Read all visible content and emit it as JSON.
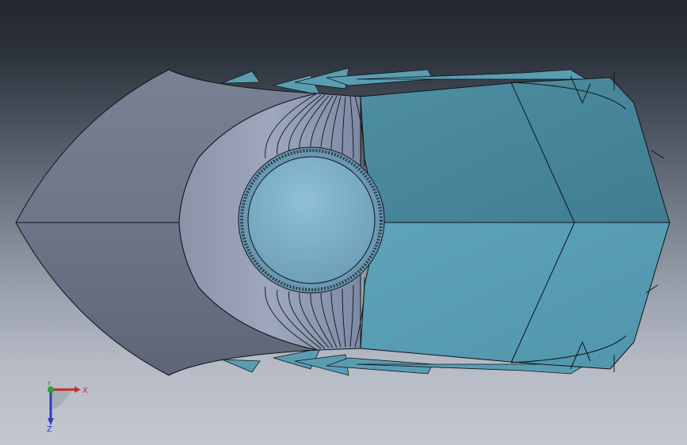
{
  "viewport": {
    "background_top": "#232830",
    "background_bottom": "#c3c7d1"
  },
  "model": {
    "left_face_color": "#6f7688",
    "right_face_color": "#4f93a8",
    "right_face_light": "#5ea5ba",
    "edge_color": "#101418",
    "boss_color": "#7fb3cc"
  },
  "triad": {
    "x_label": "X",
    "y_label": "Y",
    "z_label": "Z",
    "x_color": "#c0302a",
    "y_color": "#2aa034",
    "z_color": "#2a3ec0"
  }
}
